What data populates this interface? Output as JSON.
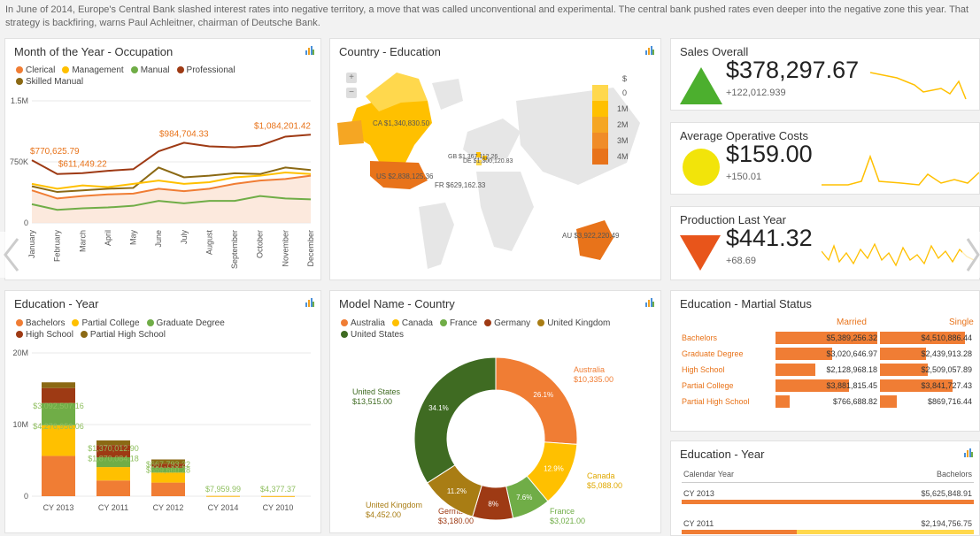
{
  "banner": "In June of 2014, Europe's Central Bank slashed interest rates into negative territory, a move that was called unconventional and experimental. The central bank pushed rates even deeper into the negative zone this year. That strategy is backfiring, warns Paul Achleitner, chairman of Deutsche Bank.",
  "occupation": {
    "title": "Month of the Year - Occupation",
    "legend": [
      {
        "name": "Clerical",
        "color": "#f07d34"
      },
      {
        "name": "Management",
        "color": "#ffc000"
      },
      {
        "name": "Manual",
        "color": "#70ad47"
      },
      {
        "name": "Professional",
        "color": "#9e3a14"
      },
      {
        "name": "Skilled Manual",
        "color": "#8b6914"
      }
    ],
    "yticks": [
      "1.5M",
      "750K",
      "0"
    ],
    "months": [
      "January",
      "February",
      "March",
      "April",
      "May",
      "June",
      "July",
      "August",
      "September",
      "October",
      "November",
      "December"
    ],
    "labels": [
      "$770,625.79",
      "$611,449.22",
      "$984,704.33",
      "$1,084,201.42"
    ]
  },
  "country_edu": {
    "title": "Country - Education",
    "scale": [
      "$",
      "0",
      "1M",
      "2M",
      "3M",
      "4M"
    ],
    "labels": [
      "CA $1,340,830.50",
      "GB $1,367,112.26",
      "DE $1,300,120.83",
      "US $2,838,125.36",
      "FR $629,162.33",
      "AU $3,922,220.49"
    ]
  },
  "kpis": [
    {
      "title": "Sales Overall",
      "value": "$378,297.67",
      "delta": "+122,012.939",
      "color": "#4caf2e"
    },
    {
      "title": "Average Operative Costs",
      "value": "$159.00",
      "delta": "+150.01",
      "color": "#f2e40a"
    },
    {
      "title": "Production Last Year",
      "value": "$441.32",
      "delta": "+68.69",
      "color": "#e8551b"
    }
  ],
  "edu_year": {
    "title": "Education - Year",
    "legend": [
      {
        "name": "Bachelors",
        "color": "#f07d34"
      },
      {
        "name": "Partial College",
        "color": "#ffc000"
      },
      {
        "name": "Graduate Degree",
        "color": "#70ad47"
      },
      {
        "name": "High School",
        "color": "#9e3a14"
      },
      {
        "name": "Partial High School",
        "color": "#8b6914"
      }
    ],
    "yticks": [
      "20M",
      "10M",
      "0"
    ],
    "categories": [
      "CY 2013",
      "CY 2011",
      "CY 2012",
      "CY 2014",
      "CY 2010"
    ],
    "labels": [
      "$3,092,507.16",
      "$4,276,956.06",
      "$1,370,012.90",
      "$1,870,084.18",
      "$667,793.22",
      "$559,660.28",
      "$7,959.99",
      "$4,377.37"
    ]
  },
  "model": {
    "title": "Model Name - Country",
    "legend": [
      {
        "name": "Australia",
        "color": "#f07d34"
      },
      {
        "name": "Canada",
        "color": "#ffc000"
      },
      {
        "name": "France",
        "color": "#70ad47"
      },
      {
        "name": "Germany",
        "color": "#9e3a14"
      },
      {
        "name": "United Kingdom",
        "color": "#a97d14"
      },
      {
        "name": "United States",
        "color": "#3f6b22"
      }
    ],
    "callouts": [
      {
        "name": "Australia",
        "value": "$10,335.00",
        "pct": "26.1%"
      },
      {
        "name": "Canada",
        "value": "$5,088.00",
        "pct": "12.9%"
      },
      {
        "name": "France",
        "value": "$3,021.00",
        "pct": "7.6%"
      },
      {
        "name": "Germany",
        "value": "$3,180.00",
        "pct": "8%"
      },
      {
        "name": "United Kingdom",
        "value": "$4,452.00",
        "pct": "11.2%"
      },
      {
        "name": "United States",
        "value": "$13,515.00",
        "pct": "34.1%"
      }
    ]
  },
  "marital": {
    "title": "Education - Martial Status",
    "col1": "Married",
    "col2": "Single",
    "rows": [
      {
        "label": "Bachelors",
        "married": "$5,389,256.32",
        "single": "$4,510,886.44"
      },
      {
        "label": "Graduate Degree",
        "married": "$3,020,646.97",
        "single": "$2,439,913.28"
      },
      {
        "label": "High School",
        "married": "$2,128,968.18",
        "single": "$2,509,057.89"
      },
      {
        "label": "Partial College",
        "married": "$3,881,815.45",
        "single": "$3,841,727.43"
      },
      {
        "label": "Partial High School",
        "married": "$766,688.82",
        "single": "$869,716.44"
      }
    ]
  },
  "edu_year2": {
    "title": "Education - Year",
    "col1": "Calendar Year",
    "col2": "Bachelors",
    "rows": [
      {
        "year": "CY 2013",
        "value": "$5,625,848.91"
      },
      {
        "year": "CY 2011",
        "value": "$2,194,756.75"
      }
    ]
  },
  "chart_data": [
    {
      "type": "line",
      "title": "Month of the Year - Occupation",
      "categories": [
        "January",
        "February",
        "March",
        "April",
        "May",
        "June",
        "July",
        "August",
        "September",
        "October",
        "November",
        "December"
      ],
      "ylim": [
        0,
        1500000
      ],
      "series": [
        {
          "name": "Professional",
          "values": [
            770625.79,
            600000,
            611449.22,
            640000,
            660000,
            880000,
            984704.33,
            940000,
            930000,
            950000,
            1060000,
            1084201.42
          ]
        },
        {
          "name": "Skilled Manual",
          "values": [
            450000,
            380000,
            400000,
            420000,
            430000,
            680000,
            560000,
            580000,
            610000,
            600000,
            680000,
            650000
          ]
        },
        {
          "name": "Management",
          "values": [
            480000,
            420000,
            460000,
            440000,
            480000,
            520000,
            480000,
            500000,
            560000,
            580000,
            620000,
            600000
          ]
        },
        {
          "name": "Clerical",
          "values": [
            400000,
            300000,
            330000,
            350000,
            360000,
            420000,
            390000,
            420000,
            480000,
            520000,
            540000,
            580000
          ]
        },
        {
          "name": "Manual",
          "values": [
            230000,
            160000,
            180000,
            190000,
            210000,
            270000,
            240000,
            270000,
            270000,
            330000,
            300000,
            290000
          ]
        }
      ]
    },
    {
      "type": "bar",
      "title": "Education - Year",
      "categories": [
        "CY 2013",
        "CY 2011",
        "CY 2012",
        "CY 2014",
        "CY 2010"
      ],
      "ylim": [
        0,
        20000000
      ],
      "series": [
        {
          "name": "Bachelors",
          "values": [
            5625848.91,
            2194756.75,
            1900000,
            20000,
            10000
          ]
        },
        {
          "name": "Partial College",
          "values": [
            4276956.06,
            1870084.18,
            1400000,
            7959.99,
            4377.37
          ]
        },
        {
          "name": "Graduate Degree",
          "values": [
            3092507.16,
            1370012.9,
            667793.22,
            0,
            0
          ]
        },
        {
          "name": "High School",
          "values": [
            2100000,
            1700000,
            559660.28,
            0,
            0
          ]
        },
        {
          "name": "Partial High School",
          "values": [
            800000,
            650000,
            600000,
            0,
            0
          ]
        }
      ]
    },
    {
      "type": "pie",
      "title": "Model Name - Country",
      "categories": [
        "Australia",
        "Canada",
        "France",
        "Germany",
        "United Kingdom",
        "United States"
      ],
      "values": [
        10335,
        5088,
        3021,
        3180,
        4452,
        13515
      ]
    }
  ]
}
